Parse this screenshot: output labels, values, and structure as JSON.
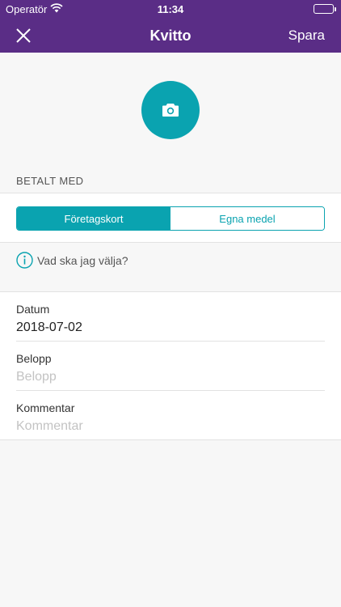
{
  "status_bar": {
    "carrier": "Operatör",
    "time": "11:34"
  },
  "nav": {
    "title": "Kvitto",
    "save_label": "Spara"
  },
  "payment": {
    "section_label": "BETALT MED",
    "options": [
      "Företagskort",
      "Egna medel"
    ],
    "selected": "Företagskort",
    "help_text": "Vad ska jag välja?"
  },
  "fields": {
    "date": {
      "label": "Datum",
      "value": "2018-07-02",
      "placeholder": ""
    },
    "amount": {
      "label": "Belopp",
      "value": "",
      "placeholder": "Belopp"
    },
    "comment": {
      "label": "Kommentar",
      "value": "",
      "placeholder": "Kommentar"
    }
  },
  "colors": {
    "header": "#5a2d86",
    "accent": "#0aa3b0",
    "background": "#f7f7f7"
  },
  "icons": {
    "close": "close-icon",
    "camera": "camera-icon",
    "info": "info-icon",
    "wifi": "wifi-icon",
    "battery": "battery-icon"
  }
}
